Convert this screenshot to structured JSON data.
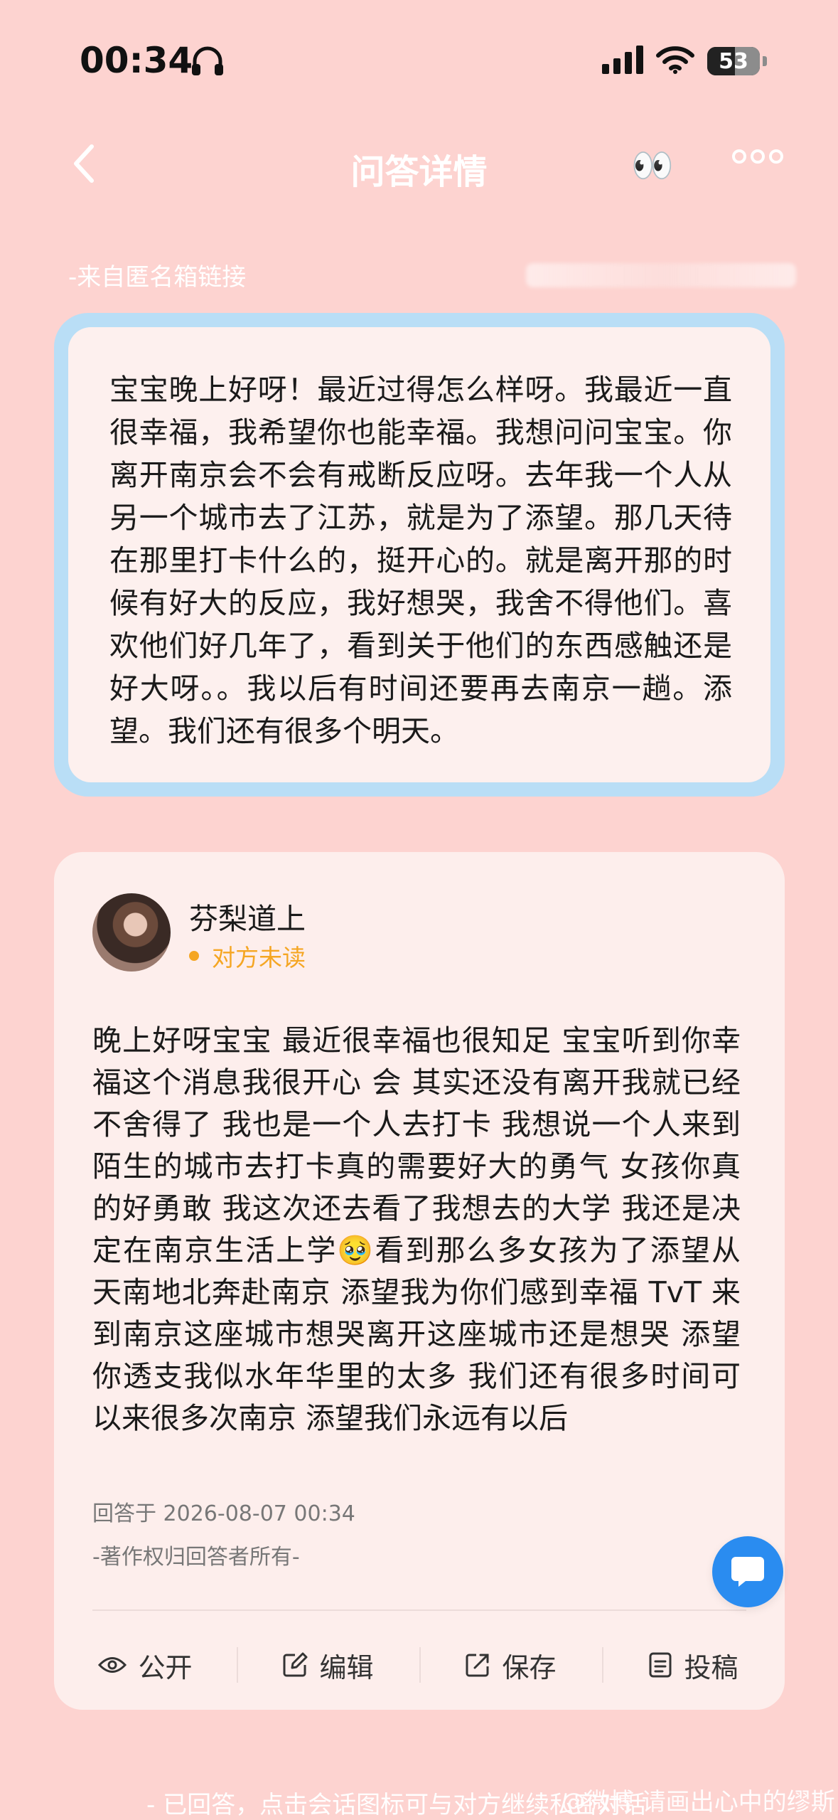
{
  "status_bar": {
    "time": "00:34",
    "battery": "53",
    "battery_level_percent": 53
  },
  "nav": {
    "title": "问答详情",
    "eyes_emoji": "👀"
  },
  "question": {
    "source": "-来自匿名箱链接",
    "text": "宝宝晚上好呀！最近过得怎么样呀。我最近一直很幸福，我希望你也能幸福。我想问问宝宝。你离开南京会不会有戒断反应呀。去年我一个人从另一个城市去了江苏，就是为了添望。那几天待在那里打卡什么的，挺开心的。就是离开那的时候有好大的反应，我好想哭，我舍不得他们。喜欢他们好几年了，看到关于他们的东西感触还是好大呀。。我以后有时间还要再去南京一趟。添望。我们还有很多个明天。"
  },
  "answer": {
    "author": "芬梨道上",
    "status": "对方未读",
    "text": "晚上好呀宝宝 最近很幸福也很知足 宝宝听到你幸福这个消息我很开心 会 其实还没有离开我就已经不舍得了 我也是一个人去打卡 我想说一个人来到陌生的城市去打卡真的需要好大的勇气 女孩你真的好勇敢 我这次还去看了我想去的大学 我还是决定在南京生活上学🥹看到那么多女孩为了添望从天南地北奔赴南京 添望我为你们感到幸福 TvT 来到南京这座城市想哭离开这座城市还是想哭 添望你透支我似水年华里的太多 我们还有很多时间可以来很多次南京 添望我们永远有以后",
    "answered_at": "回答于 2026-08-07 00:34",
    "copyright": "-著作权归回答者所有-"
  },
  "actions": [
    {
      "label": "公开",
      "icon": "eye-icon"
    },
    {
      "label": "编辑",
      "icon": "edit-icon"
    },
    {
      "label": "保存",
      "icon": "save-icon"
    },
    {
      "label": "投稿",
      "icon": "submit-icon"
    }
  ],
  "bottom_hint": "- 已回答，点击会话图标可与对方继续私密对话",
  "watermark": "@微博 请画出心中的缪斯",
  "colors": {
    "background": "#fdd3d0",
    "question_border": "#b9def6",
    "card": "#fdeeec",
    "unread": "#f5a623",
    "fab": "#2a8cf0"
  }
}
